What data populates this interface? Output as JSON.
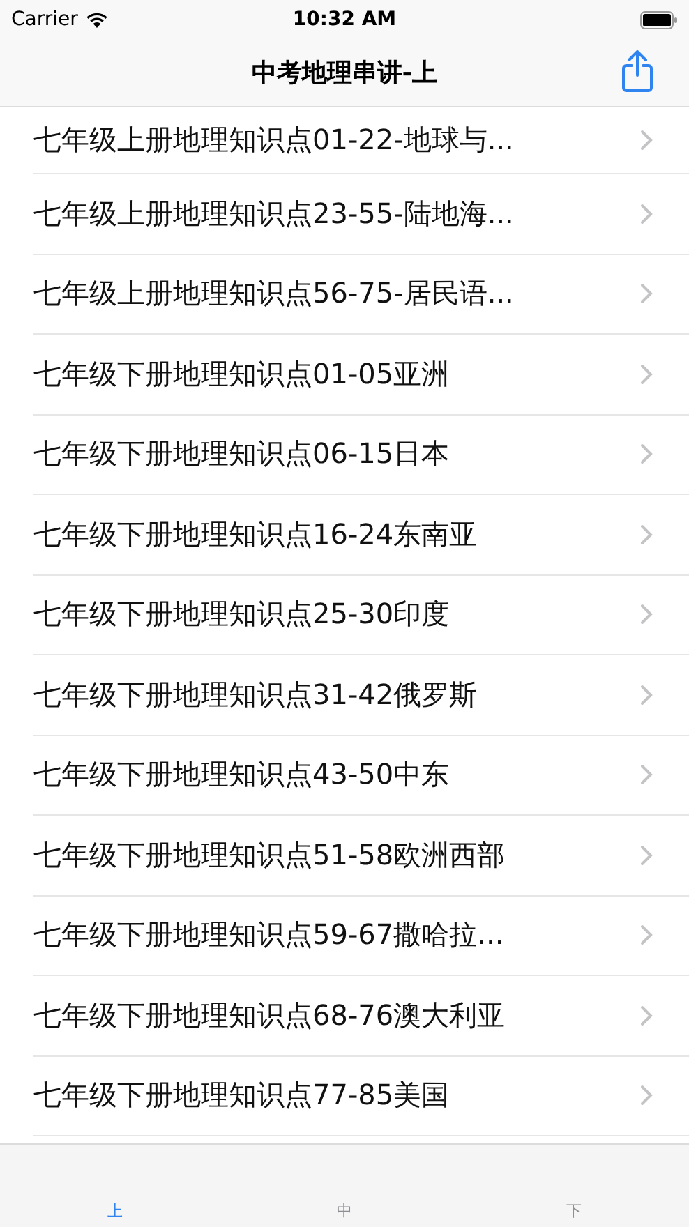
{
  "status_bar": {
    "carrier": "Carrier",
    "time": "10:32 AM"
  },
  "nav_bar": {
    "title": "中考地理串讲-上"
  },
  "rows": [
    {
      "title": "七年级上册地理知识点01-22-地球与..."
    },
    {
      "title": "七年级上册地理知识点23-55-陆地海..."
    },
    {
      "title": "七年级上册地理知识点56-75-居民语..."
    },
    {
      "title": "七年级下册地理知识点01-05亚洲"
    },
    {
      "title": "七年级下册地理知识点06-15日本"
    },
    {
      "title": "七年级下册地理知识点16-24东南亚"
    },
    {
      "title": "七年级下册地理知识点25-30印度"
    },
    {
      "title": "七年级下册地理知识点31-42俄罗斯"
    },
    {
      "title": "七年级下册地理知识点43-50中东"
    },
    {
      "title": "七年级下册地理知识点51-58欧洲西部"
    },
    {
      "title": "七年级下册地理知识点59-67撒哈拉..."
    },
    {
      "title": "七年级下册地理知识点68-76澳大利亚"
    },
    {
      "title": "七年级下册地理知识点77-85美国"
    }
  ],
  "tab_bar": [
    {
      "label": "上",
      "selected": true
    },
    {
      "label": "中",
      "selected": false
    },
    {
      "label": "下",
      "selected": false
    }
  ]
}
